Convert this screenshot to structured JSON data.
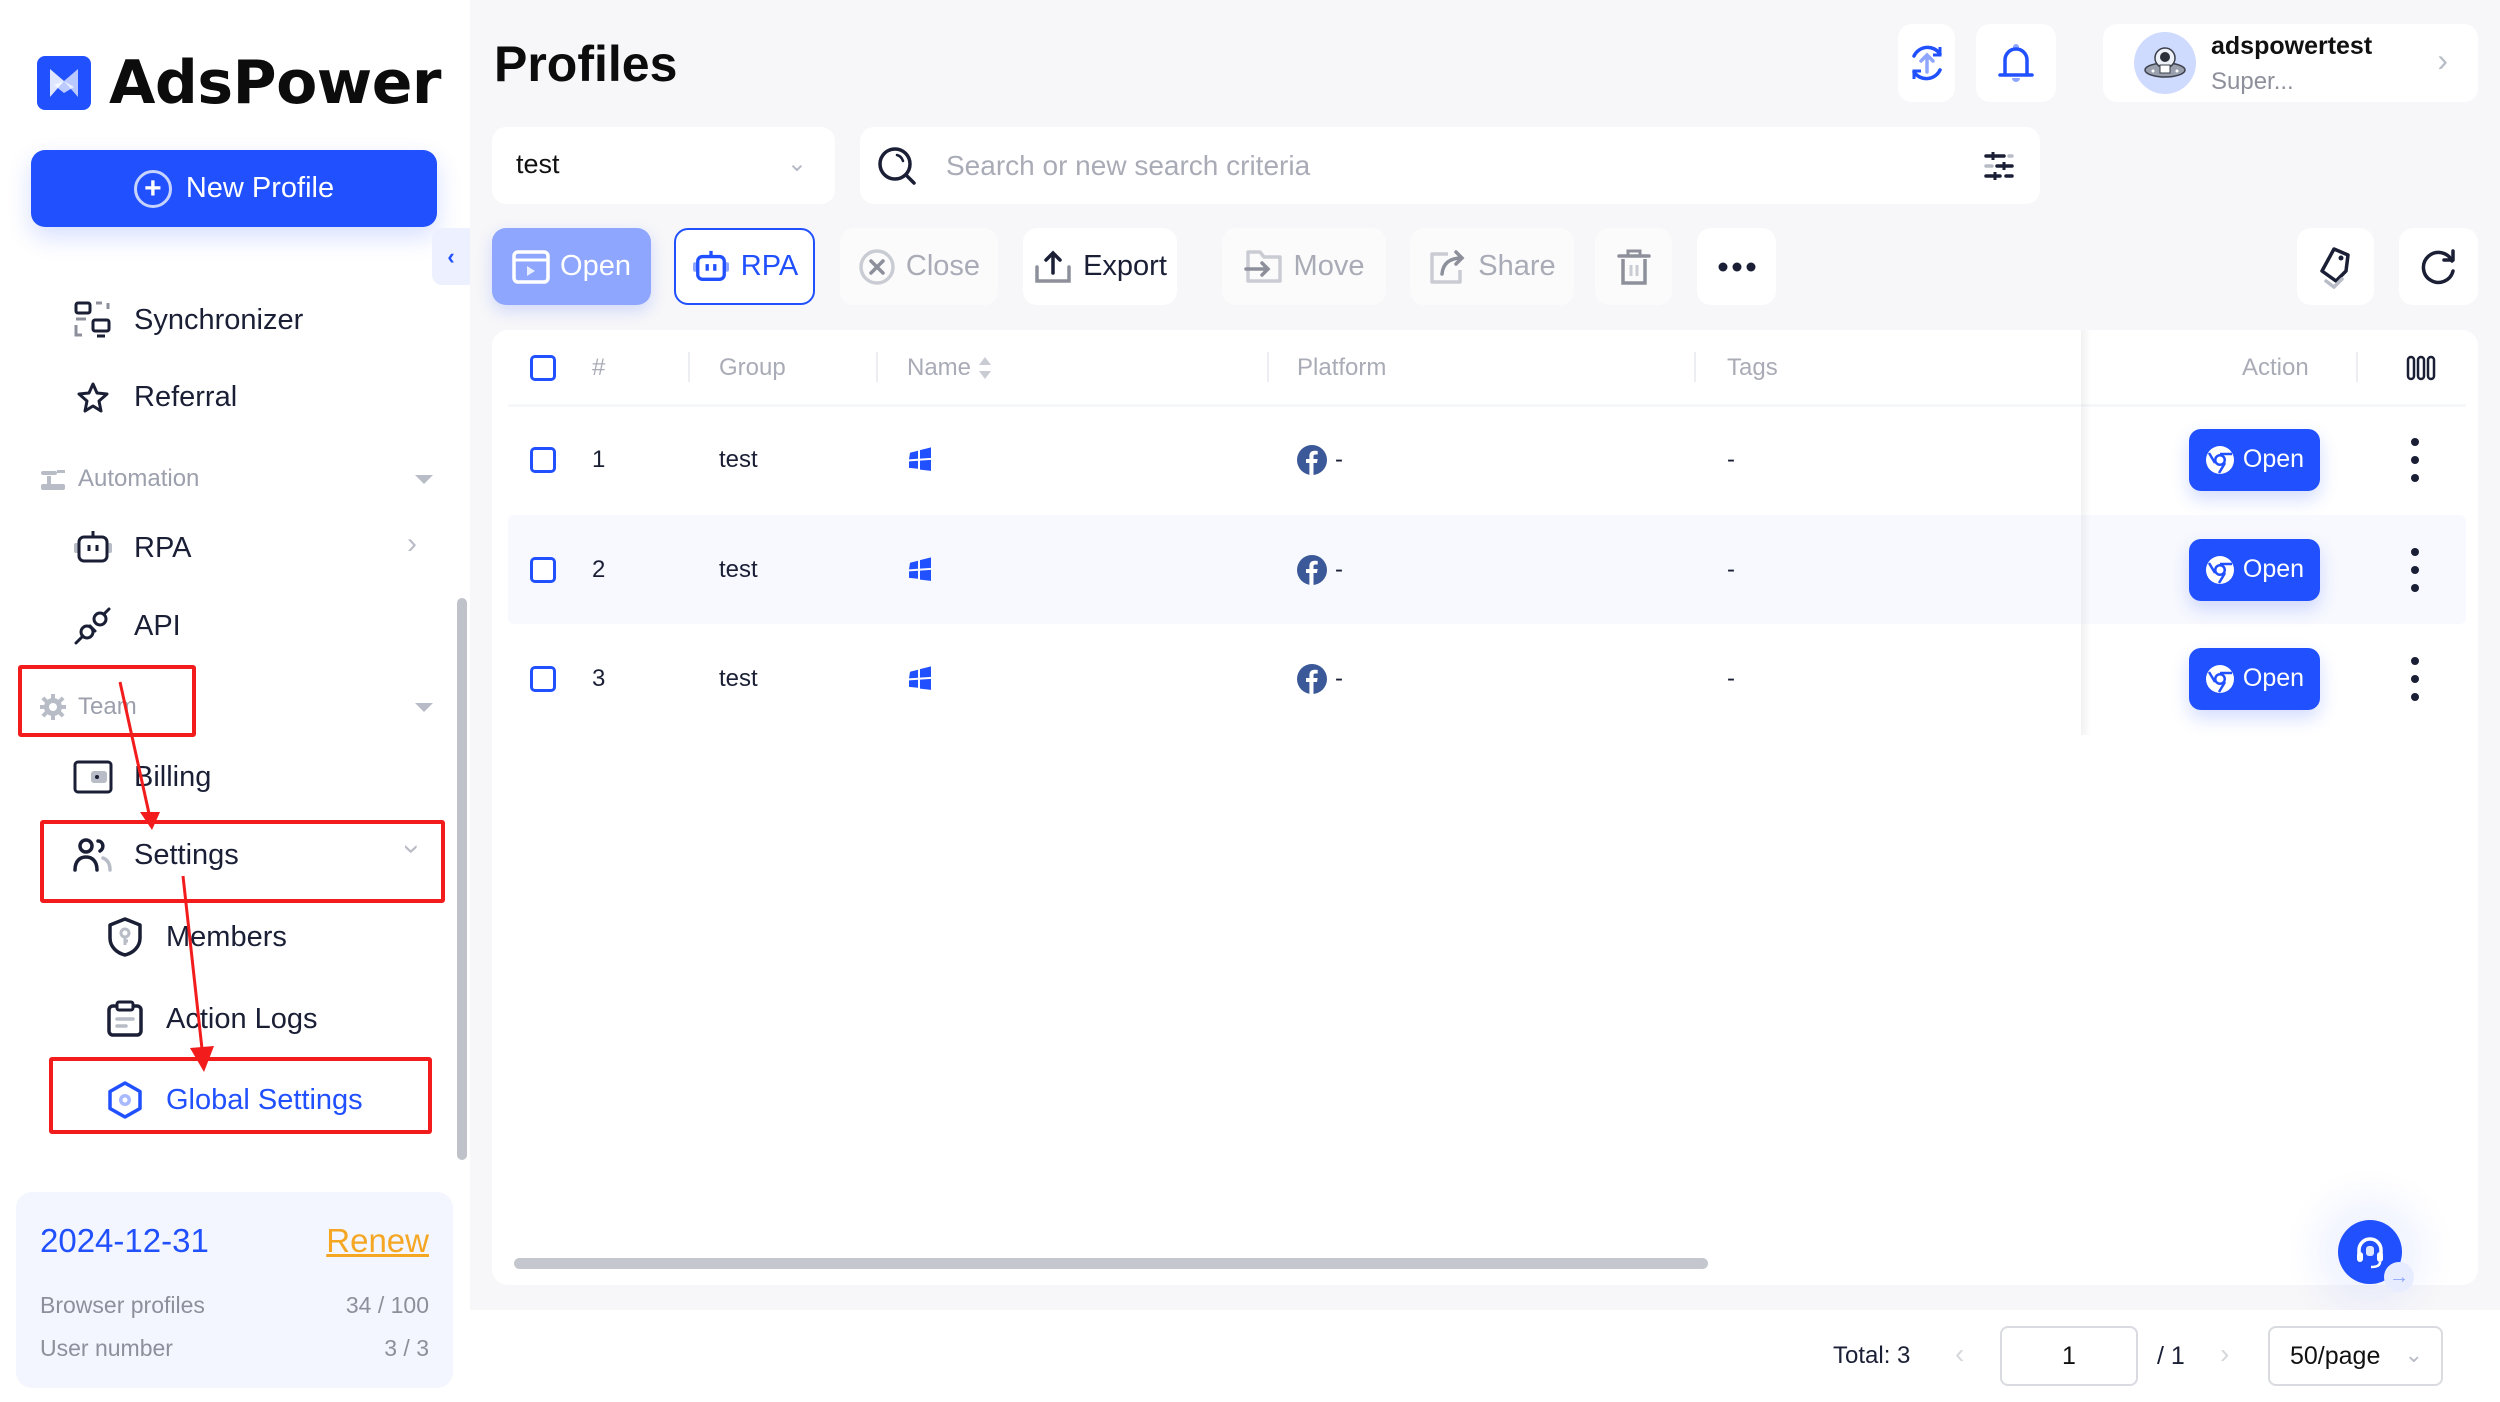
{
  "app": {
    "name": "AdsPower",
    "accent": "#2150ff"
  },
  "sidebar": {
    "new_profile_label": "New Profile",
    "items": {
      "synchronizer": "Synchronizer",
      "referral": "Referral",
      "automation": "Automation",
      "rpa": "RPA",
      "api": "API",
      "team": "Team",
      "billing": "Billing",
      "settings": "Settings",
      "members": "Members",
      "action_logs": "Action Logs",
      "global_settings": "Global Settings"
    },
    "active_item": "Global Settings",
    "plan": {
      "expiry": "2024-12-31",
      "renew_label": "Renew",
      "browser_profiles_label": "Browser profiles",
      "browser_profiles_value": "34 / 100",
      "user_number_label": "User number",
      "user_number_value": "3 / 3"
    }
  },
  "header": {
    "title": "Profiles",
    "user": {
      "name": "adspowertest",
      "role": "Super..."
    }
  },
  "filters": {
    "group_value": "test",
    "search_placeholder": "Search or new search criteria",
    "search_value": ""
  },
  "toolbar": {
    "open": "Open",
    "rpa": "RPA",
    "close": "Close",
    "export": "Export",
    "move": "Move",
    "share": "Share"
  },
  "table": {
    "columns": {
      "index": "#",
      "group": "Group",
      "name": "Name",
      "platform": "Platform",
      "tags": "Tags",
      "action": "Action"
    },
    "rows": [
      {
        "index": "1",
        "group": "test",
        "os": "windows",
        "platform_icon": "facebook",
        "platform_text": "-",
        "tags": "-",
        "action": "Open"
      },
      {
        "index": "2",
        "group": "test",
        "os": "windows",
        "platform_icon": "facebook",
        "platform_text": "-",
        "tags": "-",
        "action": "Open"
      },
      {
        "index": "3",
        "group": "test",
        "os": "windows",
        "platform_icon": "facebook",
        "platform_text": "-",
        "tags": "-",
        "action": "Open"
      }
    ]
  },
  "pagination": {
    "total_label": "Total: 3",
    "current_page": "1",
    "of_pages": "/ 1",
    "page_size": "50/page"
  }
}
